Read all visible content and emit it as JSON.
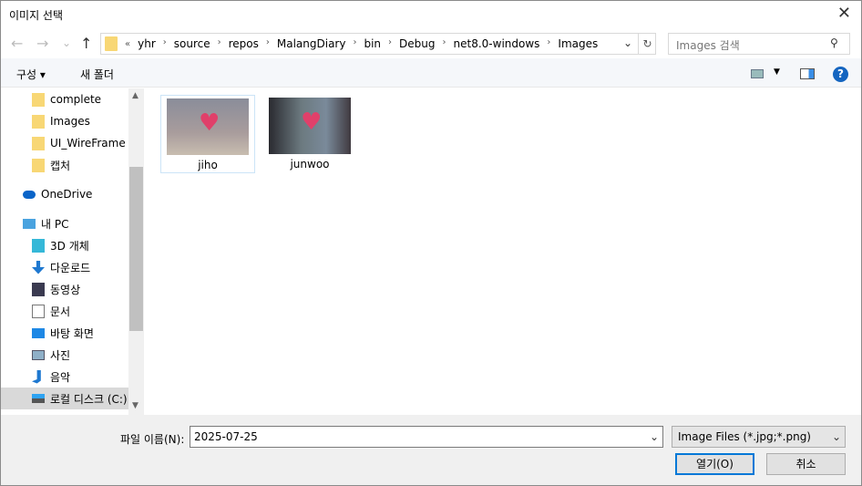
{
  "window": {
    "title": "이미지 선택",
    "close": "✕"
  },
  "nav": {
    "back": "←",
    "forward": "→",
    "recent": "⌄",
    "up": "↑",
    "refresh": "↻",
    "dropdown": "⌄"
  },
  "address": {
    "overflow": "«",
    "segments": [
      "yhr",
      "source",
      "repos",
      "MalangDiary",
      "bin",
      "Debug",
      "net8.0-windows",
      "Images"
    ]
  },
  "search": {
    "placeholder": "Images 검색"
  },
  "toolbar": {
    "organize": "구성 ▾",
    "new_folder": "새 폴더",
    "help": "?"
  },
  "sidebar": {
    "items": [
      {
        "label": "complete",
        "icon": "folder-icon"
      },
      {
        "label": "Images",
        "icon": "folder-icon"
      },
      {
        "label": "UI_WireFrame",
        "icon": "folder-icon"
      },
      {
        "label": "캡처",
        "icon": "folder-icon"
      },
      {
        "label": "OneDrive",
        "icon": "cloud-icon"
      },
      {
        "label": "내 PC",
        "icon": "pc-icon"
      },
      {
        "label": "3D 개체",
        "icon": "cube-icon"
      },
      {
        "label": "다운로드",
        "icon": "download-icon"
      },
      {
        "label": "동영상",
        "icon": "video-icon"
      },
      {
        "label": "문서",
        "icon": "document-icon"
      },
      {
        "label": "바탕 화면",
        "icon": "desktop-icon"
      },
      {
        "label": "사진",
        "icon": "picture-icon"
      },
      {
        "label": "음악",
        "icon": "music-icon"
      },
      {
        "label": "로컬 디스크 (C:)",
        "icon": "drive-icon",
        "selected": true
      }
    ]
  },
  "files": [
    {
      "name": "jiho",
      "selected": true
    },
    {
      "name": "junwoo"
    }
  ],
  "footer": {
    "filename_label": "파일 이름(N):",
    "filename_value": "2025-07-25",
    "filter": "Image Files (*.jpg;*.png)",
    "open": "열기(O)",
    "cancel": "취소"
  },
  "colors": {
    "accent": "#0078d7",
    "folder": "#f8d775",
    "selection": "#cce4f7"
  }
}
